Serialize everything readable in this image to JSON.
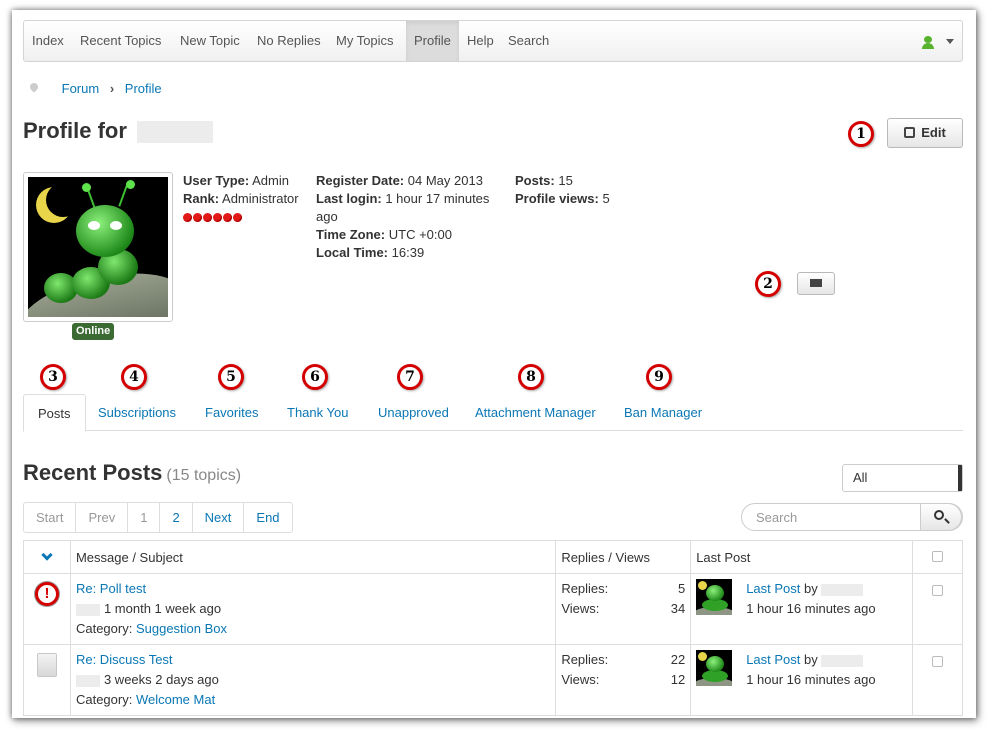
{
  "nav": {
    "items": [
      "Index",
      "Recent Topics",
      "New Topic",
      "No Replies",
      "My Topics",
      "Profile",
      "Help",
      "Search"
    ],
    "active": "Profile",
    "user_icon": "user-icon"
  },
  "breadcrumb": {
    "items": [
      "Forum",
      "Profile"
    ]
  },
  "profile": {
    "title": "Profile for",
    "edit_label": "Edit",
    "online_label": "Online",
    "user_type_label": "User Type:",
    "user_type": "Admin",
    "rank_label": "Rank:",
    "rank": "Administrator",
    "rank_stars": 6,
    "register_label": "Register Date:",
    "register_date": "04 May 2013",
    "last_login_label": "Last login:",
    "last_login": "1 hour 17 minutes ago",
    "timezone_label": "Time Zone:",
    "timezone": "UTC +0:00",
    "local_time_label": "Local Time:",
    "local_time": "16:39",
    "posts_label": "Posts:",
    "posts": "15",
    "views_label": "Profile views:",
    "views": "5"
  },
  "callouts": [
    "1",
    "2",
    "3",
    "4",
    "5",
    "6",
    "7",
    "8",
    "9"
  ],
  "tabs": [
    "Posts",
    "Subscriptions",
    "Favorites",
    "Thank You",
    "Unapproved",
    "Attachment Manager",
    "Ban Manager"
  ],
  "recent": {
    "title": "Recent Posts",
    "count": "(15 topics)",
    "filter": "All",
    "pagination": [
      "Start",
      "Prev",
      "1",
      "2",
      "Next",
      "End"
    ],
    "search_placeholder": "Search",
    "columns": {
      "subject": "Message / Subject",
      "stats": "Replies / Views",
      "last": "Last Post"
    },
    "rows": [
      {
        "icon": "alert-icon",
        "subject": "Re: Poll test",
        "time": "1 month 1 week ago",
        "category_label": "Category:",
        "category": "Suggestion Box",
        "replies_label": "Replies:",
        "replies": "5",
        "views_label": "Views:",
        "views": "34",
        "last_label": "Last Post",
        "by": "by",
        "last_time": "1 hour 16 minutes ago"
      },
      {
        "icon": "document-icon",
        "subject": "Re: Discuss Test",
        "time": "3 weeks 2 days ago",
        "category_label": "Category:",
        "category": "Welcome Mat",
        "replies_label": "Replies:",
        "replies": "22",
        "views_label": "Views:",
        "views": "12",
        "last_label": "Last Post",
        "by": "by",
        "last_time": "1 hour 16 minutes ago"
      }
    ]
  },
  "colors": {
    "link": "#0a77b5",
    "callout_ring": "#d40000",
    "online": "#3b6b32",
    "rank": "#e31919"
  }
}
